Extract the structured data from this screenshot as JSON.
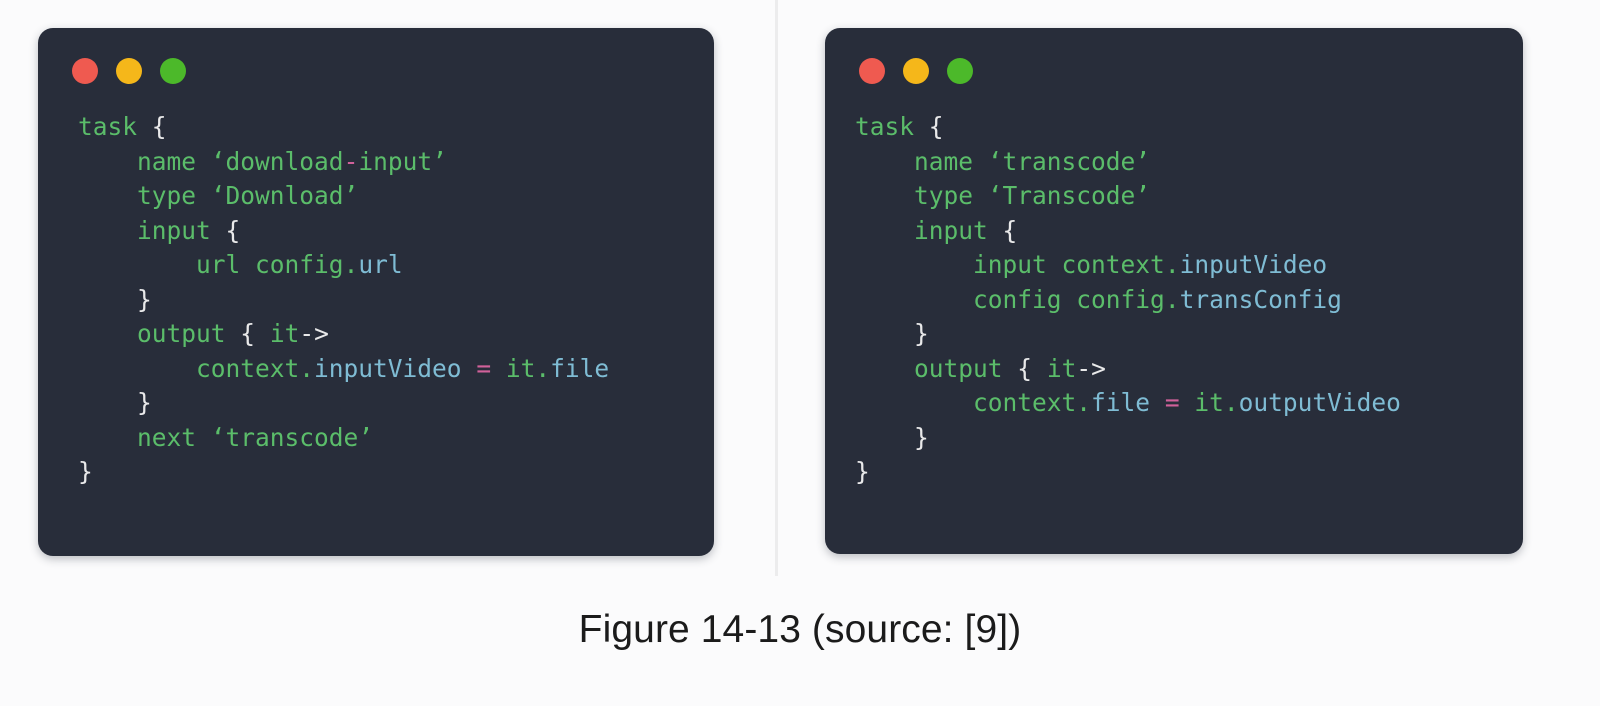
{
  "page": {
    "background_color": "#fbfbfc",
    "caption": "Figure 14-13 (source: [9])"
  },
  "theme": {
    "editor_background": "#282d3a",
    "keyword_color": "#5bbd6a",
    "string_color": "#5bbd6a",
    "property_color": "#7fbcd4",
    "operator_color": "#d1619a",
    "punctuation_color": "#e9e9ea",
    "dot_red": "#ef5a50",
    "dot_yellow": "#f5b71a",
    "dot_green": "#4cb92a"
  },
  "panels": [
    {
      "id": "download-input-task",
      "window_controls": [
        {
          "name": "close-dot",
          "color": "#ef5a50"
        },
        {
          "name": "minimize-dot",
          "color": "#f5b71a"
        },
        {
          "name": "maximize-dot",
          "color": "#4cb92a"
        }
      ],
      "code_lines": [
        {
          "indent": 0,
          "tokens": [
            {
              "t": "task",
              "c": "kw"
            },
            {
              "t": " ",
              "c": "plain"
            },
            {
              "t": "{",
              "c": "pun"
            }
          ]
        },
        {
          "indent": 1,
          "tokens": [
            {
              "t": "name",
              "c": "kw"
            },
            {
              "t": " ",
              "c": "plain"
            },
            {
              "t": "‘download",
              "c": "str"
            },
            {
              "t": "-",
              "c": "op"
            },
            {
              "t": "input’",
              "c": "str"
            }
          ]
        },
        {
          "indent": 1,
          "tokens": [
            {
              "t": "type",
              "c": "kw"
            },
            {
              "t": " ",
              "c": "plain"
            },
            {
              "t": "‘Download’",
              "c": "str"
            }
          ]
        },
        {
          "indent": 1,
          "tokens": [
            {
              "t": "input",
              "c": "kw"
            },
            {
              "t": " ",
              "c": "plain"
            },
            {
              "t": "{",
              "c": "pun"
            }
          ]
        },
        {
          "indent": 2,
          "tokens": [
            {
              "t": "url",
              "c": "kw"
            },
            {
              "t": " ",
              "c": "plain"
            },
            {
              "t": "config",
              "c": "kw"
            },
            {
              "t": ".",
              "c": "kw"
            },
            {
              "t": "url",
              "c": "prop"
            }
          ]
        },
        {
          "indent": 1,
          "tokens": [
            {
              "t": "}",
              "c": "pun"
            }
          ]
        },
        {
          "indent": 1,
          "tokens": [
            {
              "t": "output",
              "c": "kw"
            },
            {
              "t": " ",
              "c": "plain"
            },
            {
              "t": "{",
              "c": "pun"
            },
            {
              "t": " ",
              "c": "plain"
            },
            {
              "t": "it",
              "c": "kw"
            },
            {
              "t": "->",
              "c": "pun"
            }
          ]
        },
        {
          "indent": 2,
          "tokens": [
            {
              "t": "context",
              "c": "kw"
            },
            {
              "t": ".",
              "c": "kw"
            },
            {
              "t": "inputVideo",
              "c": "prop"
            },
            {
              "t": " ",
              "c": "plain"
            },
            {
              "t": "=",
              "c": "op"
            },
            {
              "t": " ",
              "c": "plain"
            },
            {
              "t": "it",
              "c": "kw"
            },
            {
              "t": ".",
              "c": "kw"
            },
            {
              "t": "file",
              "c": "prop"
            }
          ]
        },
        {
          "indent": 1,
          "tokens": [
            {
              "t": "}",
              "c": "pun"
            }
          ]
        },
        {
          "indent": 1,
          "tokens": [
            {
              "t": "next",
              "c": "kw"
            },
            {
              "t": " ",
              "c": "plain"
            },
            {
              "t": "‘transcode’",
              "c": "str"
            }
          ]
        },
        {
          "indent": 0,
          "tokens": [
            {
              "t": "}",
              "c": "pun"
            }
          ]
        }
      ],
      "plain_text": "task {\n    name 'download-input'\n    type 'Download'\n    input {\n        url config.url\n    }\n    output { it->\n        context.inputVideo = it.file\n    }\n    next 'transcode'\n}"
    },
    {
      "id": "transcode-task",
      "window_controls": [
        {
          "name": "close-dot",
          "color": "#ef5a50"
        },
        {
          "name": "minimize-dot",
          "color": "#f5b71a"
        },
        {
          "name": "maximize-dot",
          "color": "#4cb92a"
        }
      ],
      "code_lines": [
        {
          "indent": 0,
          "tokens": [
            {
              "t": "task",
              "c": "kw"
            },
            {
              "t": " ",
              "c": "plain"
            },
            {
              "t": "{",
              "c": "pun"
            }
          ]
        },
        {
          "indent": 1,
          "tokens": [
            {
              "t": "name",
              "c": "kw"
            },
            {
              "t": " ",
              "c": "plain"
            },
            {
              "t": "‘transcode’",
              "c": "str"
            }
          ]
        },
        {
          "indent": 1,
          "tokens": [
            {
              "t": "type",
              "c": "kw"
            },
            {
              "t": " ",
              "c": "plain"
            },
            {
              "t": "‘Transcode’",
              "c": "str"
            }
          ]
        },
        {
          "indent": 1,
          "tokens": [
            {
              "t": "input",
              "c": "kw"
            },
            {
              "t": " ",
              "c": "plain"
            },
            {
              "t": "{",
              "c": "pun"
            }
          ]
        },
        {
          "indent": 2,
          "tokens": [
            {
              "t": "input",
              "c": "kw"
            },
            {
              "t": " ",
              "c": "plain"
            },
            {
              "t": "context",
              "c": "kw"
            },
            {
              "t": ".",
              "c": "kw"
            },
            {
              "t": "inputVideo",
              "c": "prop"
            }
          ]
        },
        {
          "indent": 2,
          "tokens": [
            {
              "t": "config",
              "c": "kw"
            },
            {
              "t": " ",
              "c": "plain"
            },
            {
              "t": "config",
              "c": "kw"
            },
            {
              "t": ".",
              "c": "kw"
            },
            {
              "t": "transConfig",
              "c": "prop"
            }
          ]
        },
        {
          "indent": 1,
          "tokens": [
            {
              "t": "}",
              "c": "pun"
            }
          ]
        },
        {
          "indent": 1,
          "tokens": [
            {
              "t": "output",
              "c": "kw"
            },
            {
              "t": " ",
              "c": "plain"
            },
            {
              "t": "{",
              "c": "pun"
            },
            {
              "t": " ",
              "c": "plain"
            },
            {
              "t": "it",
              "c": "kw"
            },
            {
              "t": "->",
              "c": "pun"
            }
          ]
        },
        {
          "indent": 2,
          "tokens": [
            {
              "t": "context",
              "c": "kw"
            },
            {
              "t": ".",
              "c": "kw"
            },
            {
              "t": "file",
              "c": "prop"
            },
            {
              "t": " ",
              "c": "plain"
            },
            {
              "t": "=",
              "c": "op"
            },
            {
              "t": " ",
              "c": "plain"
            },
            {
              "t": "it",
              "c": "kw"
            },
            {
              "t": ".",
              "c": "kw"
            },
            {
              "t": "outputVideo",
              "c": "prop"
            }
          ]
        },
        {
          "indent": 1,
          "tokens": [
            {
              "t": "}",
              "c": "pun"
            }
          ]
        },
        {
          "indent": 0,
          "tokens": [
            {
              "t": "}",
              "c": "pun"
            }
          ]
        }
      ],
      "plain_text": "task {\n    name 'transcode'\n    type 'Transcode'\n    input {\n        input context.inputVideo\n        config config.transConfig\n    }\n    output { it->\n        context.file = it.outputVideo\n    }\n}"
    }
  ]
}
